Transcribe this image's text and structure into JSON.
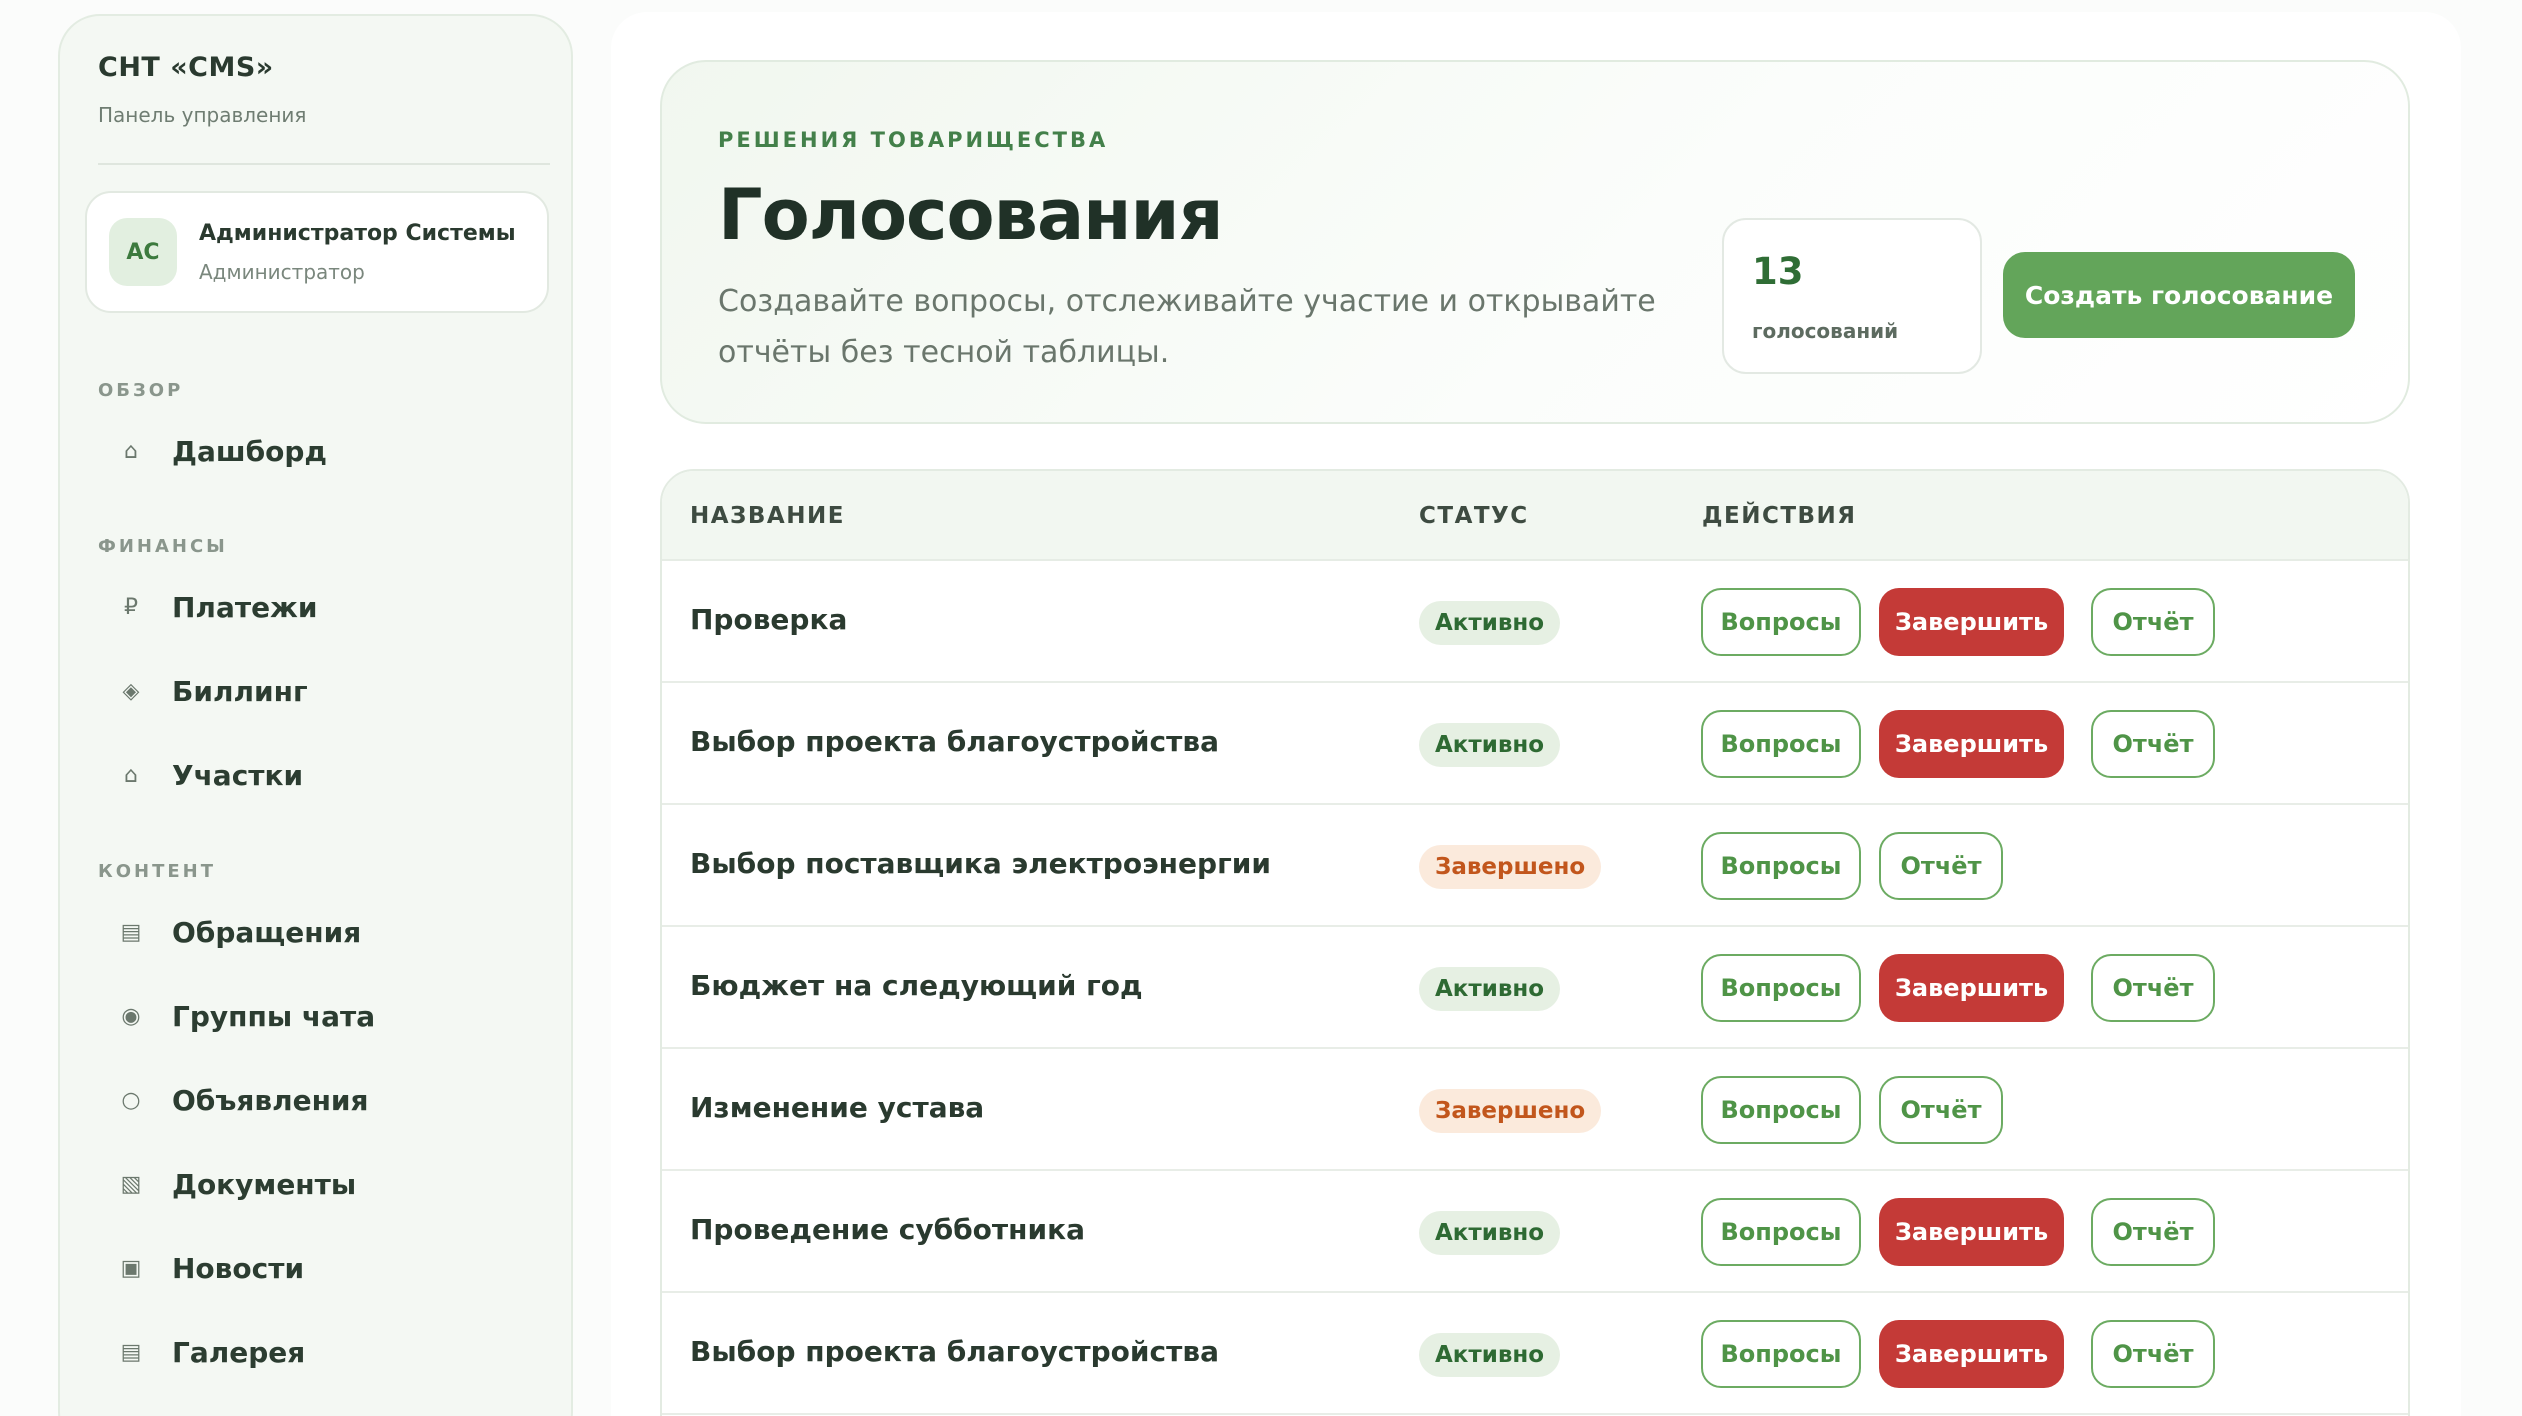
{
  "sidebar": {
    "brand_title": "СНТ «CMS»",
    "brand_subtitle": "Панель управления",
    "user": {
      "initials": "АС",
      "name": "Администратор Системы",
      "role": "Администратор"
    },
    "sections": [
      {
        "label": "ОБЗОР"
      },
      {
        "label": "ФИНАНСЫ"
      },
      {
        "label": "КОНТЕНТ"
      }
    ],
    "items": [
      {
        "icon": "⌂",
        "icon_name": "home-icon",
        "label": "Дашборд"
      },
      {
        "icon": "₽",
        "icon_name": "ruble-icon",
        "label": "Платежи"
      },
      {
        "icon": "◈",
        "icon_name": "diamond-icon",
        "label": "Биллинг"
      },
      {
        "icon": "⌂",
        "icon_name": "plot-icon",
        "label": "Участки"
      },
      {
        "icon": "▤",
        "icon_name": "list-icon",
        "label": "Обращения"
      },
      {
        "icon": "◉",
        "icon_name": "chat-group-icon",
        "label": "Группы чата"
      },
      {
        "icon": "○",
        "icon_name": "circle-icon",
        "label": "Объявления"
      },
      {
        "icon": "▧",
        "icon_name": "document-icon",
        "label": "Документы"
      },
      {
        "icon": "▣",
        "icon_name": "news-icon",
        "label": "Новости"
      },
      {
        "icon": "▤",
        "icon_name": "gallery-icon",
        "label": "Галерея"
      }
    ]
  },
  "hero": {
    "eyebrow": "РЕШЕНИЯ ТОВАРИЩЕСТВА",
    "title": "Голосования",
    "description": "Создавайте вопросы, отслеживайте участие и открывайте отчёты без тесной таблицы.",
    "stat_value": "13",
    "stat_label": "голосований",
    "create_button": "Создать голосование"
  },
  "table": {
    "headers": {
      "name": "НАЗВАНИЕ",
      "status": "СТАТУС",
      "actions": "ДЕЙСТВИЯ"
    },
    "button_labels": {
      "questions": "Вопросы",
      "finish": "Завершить",
      "report": "Отчёт"
    },
    "rows": [
      {
        "name": "Проверка",
        "status": "Активно",
        "status_type": "active"
      },
      {
        "name": "Выбор проекта благоустройства",
        "status": "Активно",
        "status_type": "active"
      },
      {
        "name": "Выбор поставщика электроэнергии",
        "status": "Завершено",
        "status_type": "done"
      },
      {
        "name": "Бюджет на следующий год",
        "status": "Активно",
        "status_type": "active"
      },
      {
        "name": "Изменение устава",
        "status": "Завершено",
        "status_type": "done"
      },
      {
        "name": "Проведение субботника",
        "status": "Активно",
        "status_type": "active"
      },
      {
        "name": "Выбор проекта благоустройства",
        "status": "Активно",
        "status_type": "active"
      }
    ]
  },
  "colors": {
    "accent_green": "#63a55a",
    "danger_red": "#c43a37",
    "active_badge": "#e6f0e3",
    "done_badge": "#fbeadc"
  }
}
